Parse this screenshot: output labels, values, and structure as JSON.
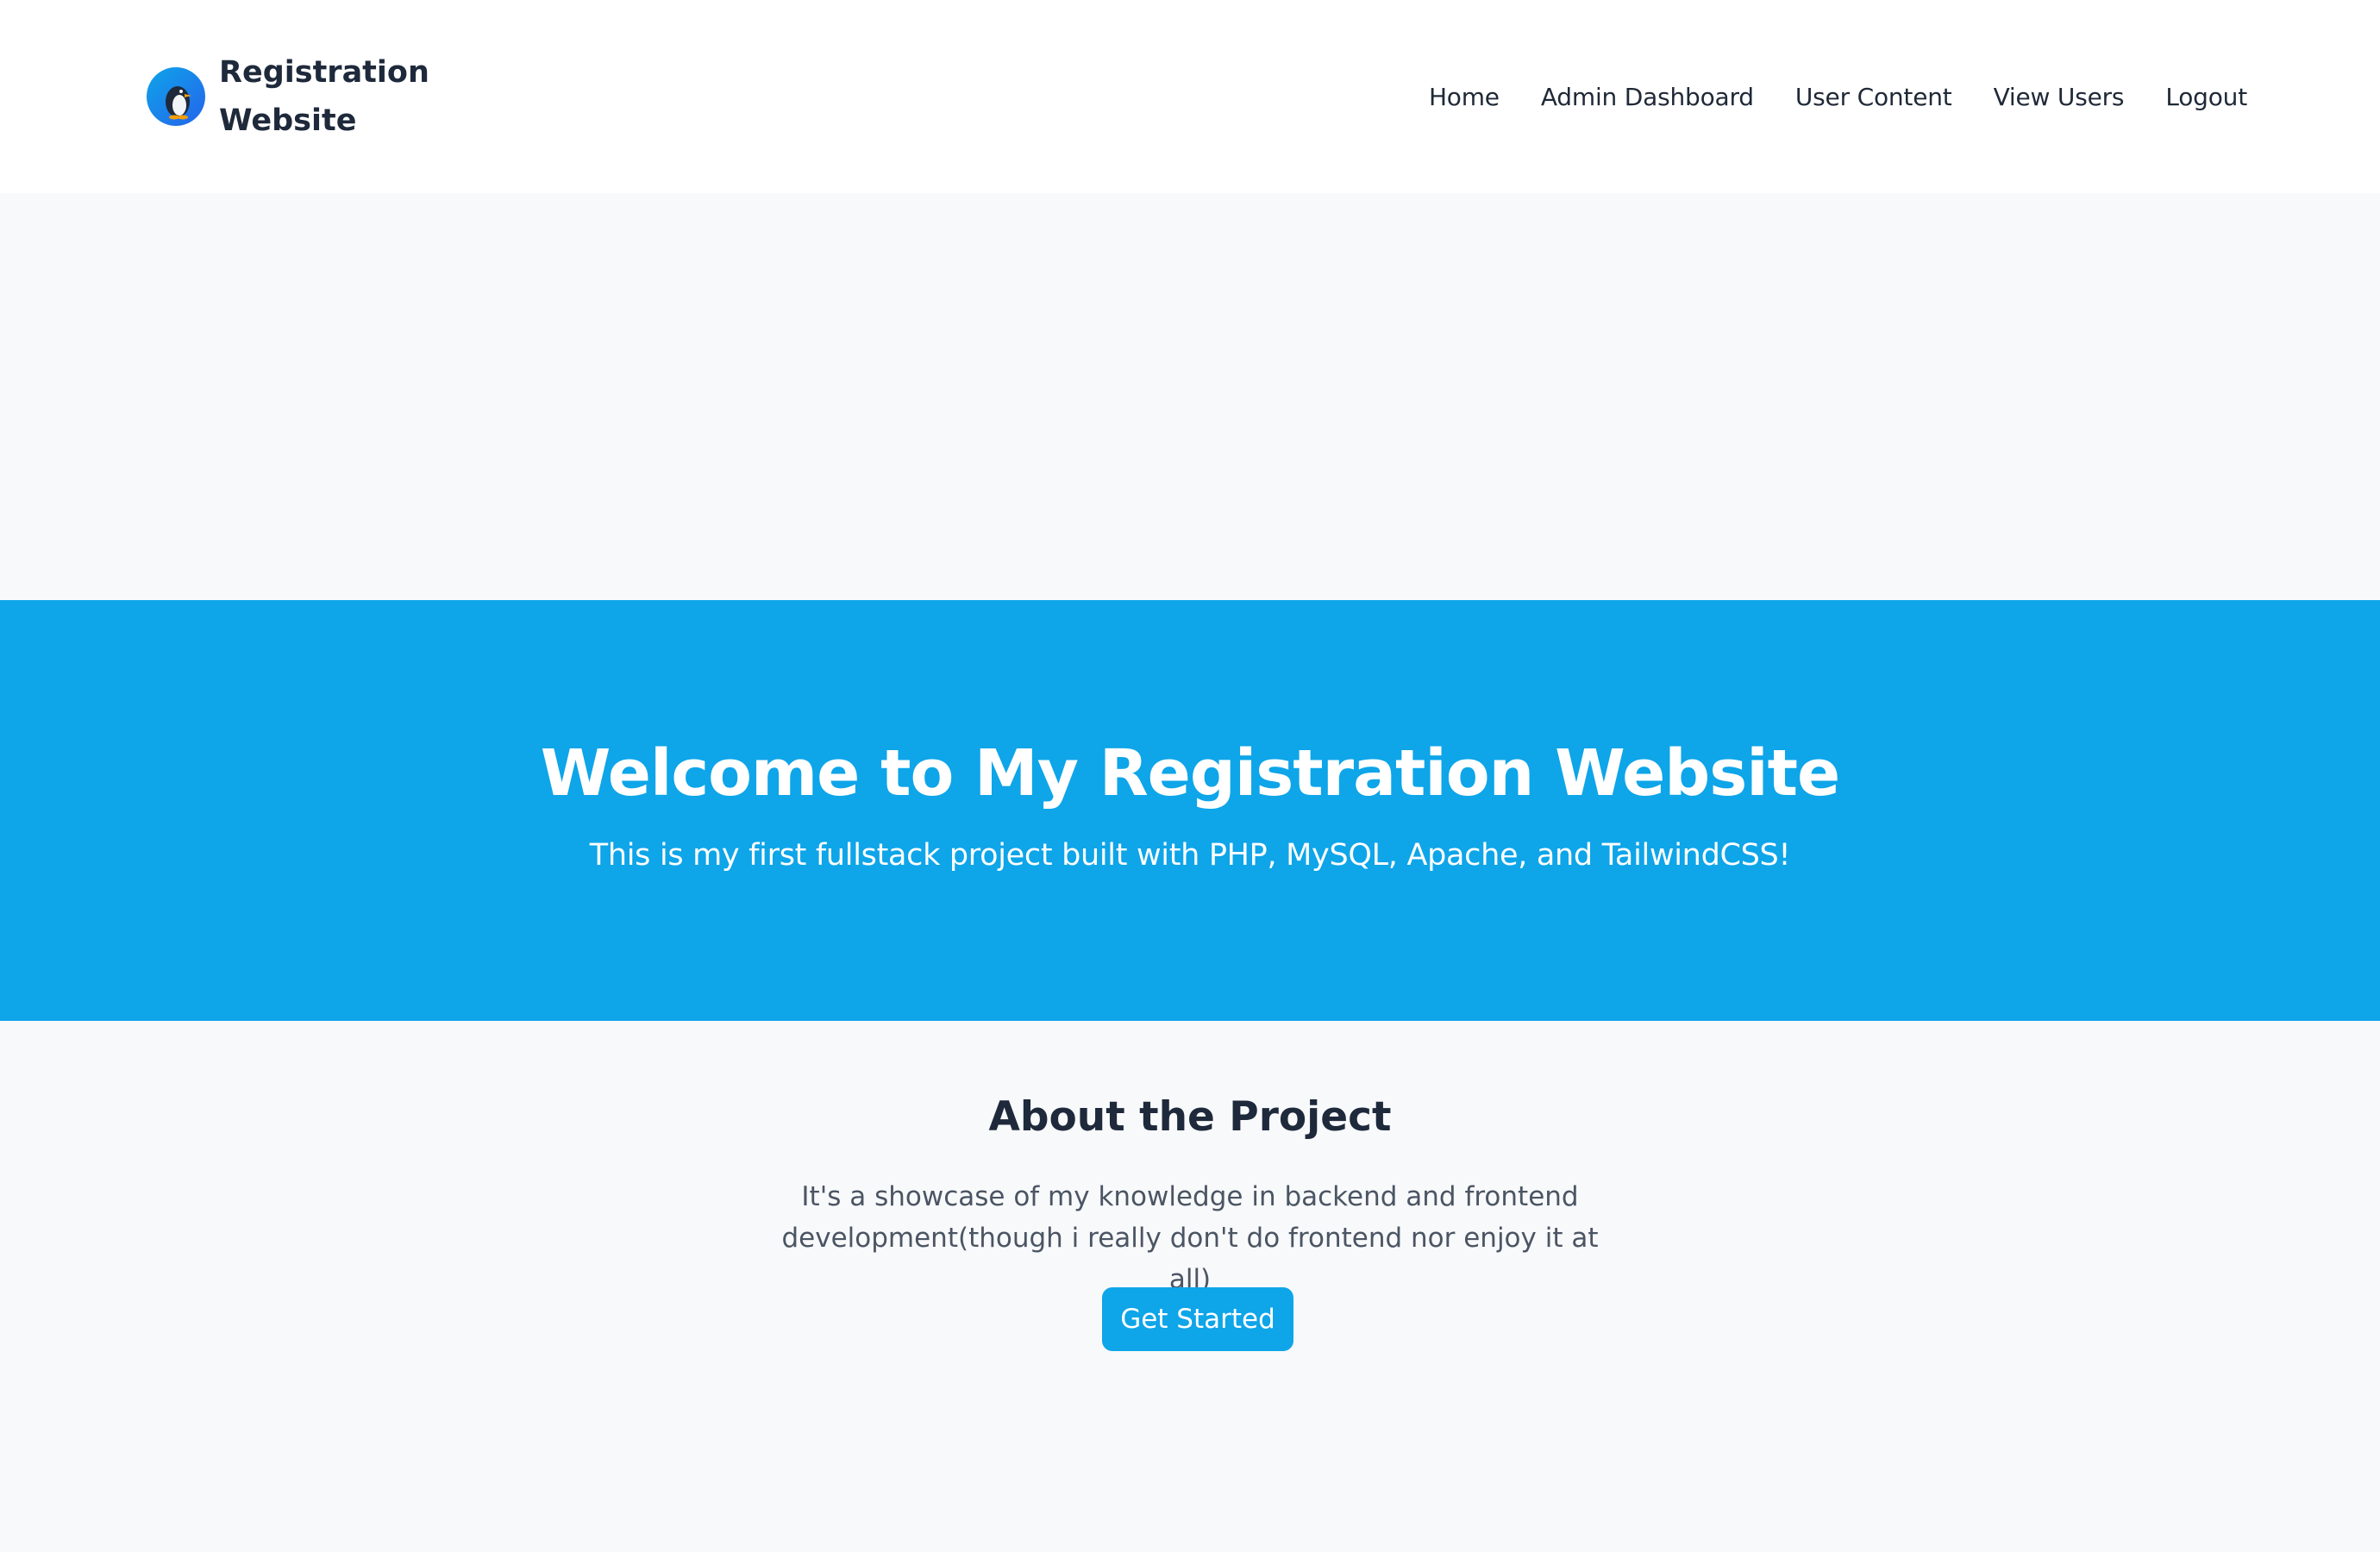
{
  "brand": {
    "name": "Registration Website",
    "logo_icon": "penguin-icon"
  },
  "nav": {
    "items": [
      "Home",
      "Admin Dashboard",
      "User Content",
      "View Users",
      "Logout"
    ]
  },
  "hero": {
    "title": "Welcome to My Registration Website",
    "subtitle": "This is my first fullstack project built with PHP, MySQL, Apache, and TailwindCSS!"
  },
  "about": {
    "heading": "About the Project",
    "text": "It's a showcase of my knowledge in backend and frontend development(though i really don't do frontend nor enjoy it at all)",
    "button_label": "Get Started"
  },
  "colors": {
    "accent": "#0ea5e9",
    "background": "#f8f9fb",
    "header_bg": "#ffffff",
    "text_dark": "#1e293b",
    "text_muted": "#4b5563"
  }
}
